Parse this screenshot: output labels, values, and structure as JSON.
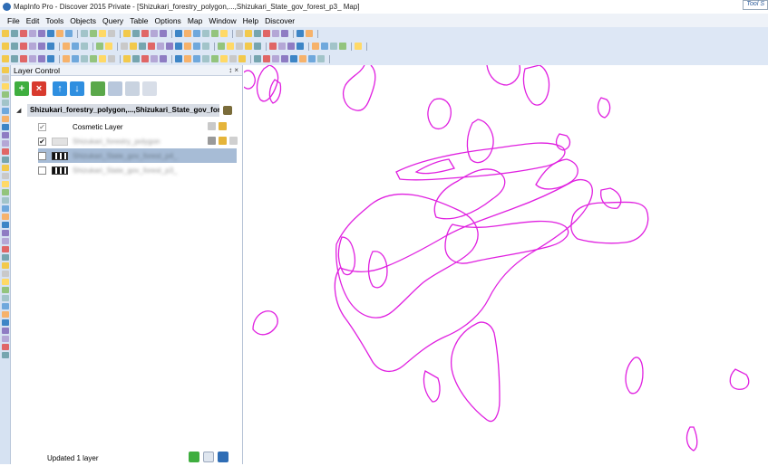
{
  "window": {
    "title": "MapInfo Pro - Discover 2015   Private - [Shizukari_forestry_polygon,...,Shizukari_State_gov_forest_p3_ Map]",
    "tool_tab": "Tool S"
  },
  "menu": {
    "items": [
      "File",
      "Edit",
      "Tools",
      "Objects",
      "Query",
      "Table",
      "Options",
      "Map",
      "Window",
      "Help",
      "Discover"
    ]
  },
  "layer_control": {
    "title": "Layer Control",
    "header_controls": "↕ ×",
    "root_label": "Shizukari_forestry_polygon,...,Shizukari_State_gov_fore",
    "layers": [
      {
        "name": "Cosmetic Layer",
        "checked": true,
        "icon": "cosmetic-icon",
        "blurred": false
      },
      {
        "name": "Shizukari_forestry_polygon",
        "checked": true,
        "icon": "folder-icon",
        "blurred": true
      },
      {
        "name": "Shizukari_State_gov_forest_p4_",
        "checked": false,
        "icon": "raster-icon",
        "blurred": true,
        "selected": true
      },
      {
        "name": "Shizukari_State_gov_forest_p3_",
        "checked": false,
        "icon": "raster-icon",
        "blurred": true
      }
    ],
    "status": "Updated 1 layer",
    "check_mark": "✔"
  },
  "colors": {
    "polygon_stroke": "#e020e0",
    "selection": "#a7bcd6",
    "toolbar_bg": "#dde7f5"
  }
}
